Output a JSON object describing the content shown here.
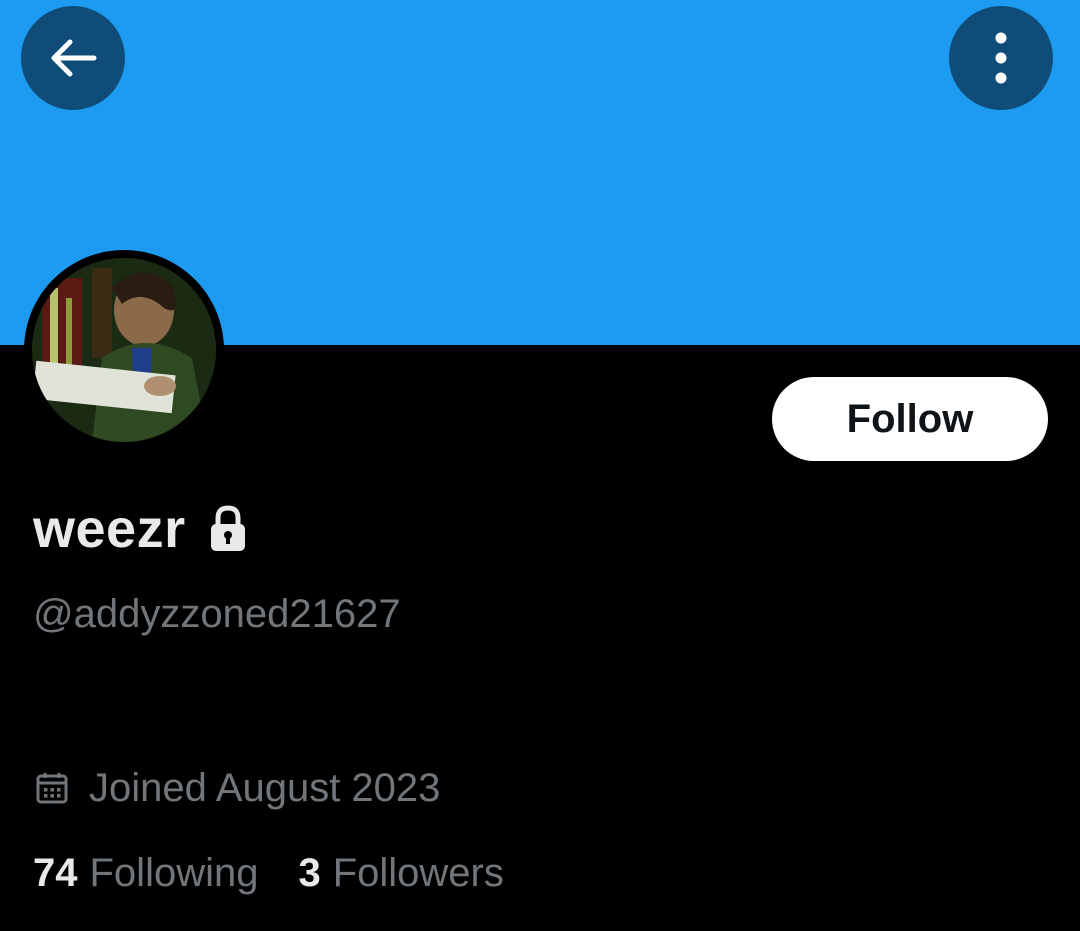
{
  "colors": {
    "banner": "#1d9bf0",
    "background": "#000000",
    "overlay_button": "#0f4d78",
    "primary_text": "#e7e9ea",
    "secondary_text": "#71767b",
    "follow_button_bg": "#ffffff",
    "follow_button_text": "#0f1419"
  },
  "header": {
    "back_icon": "arrow-left-icon",
    "more_icon": "more-vertical-icon"
  },
  "profile": {
    "display_name": "weezr",
    "protected_icon": "lock-icon",
    "handle": "@addyzzoned21627",
    "follow_label": "Follow",
    "joined_icon": "calendar-icon",
    "joined": "Joined August 2023"
  },
  "stats": {
    "following_count": "74",
    "following_label": "Following",
    "followers_count": "3",
    "followers_label": "Followers"
  }
}
